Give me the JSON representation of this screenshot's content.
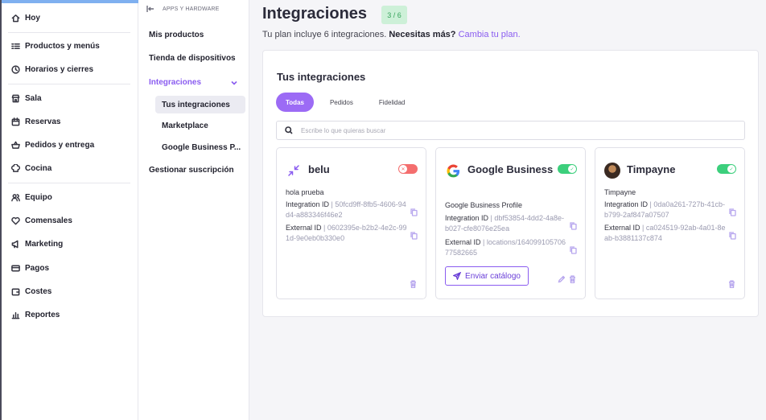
{
  "sidebar": {
    "items": [
      {
        "label": "Hoy",
        "icon": "home-icon"
      },
      {
        "label": "Productos y menús",
        "icon": "list-icon"
      },
      {
        "label": "Horarios y cierres",
        "icon": "clock-icon"
      },
      {
        "label": "Sala",
        "icon": "store-icon"
      },
      {
        "label": "Reservas",
        "icon": "calendar-icon"
      },
      {
        "label": "Pedidos y entrega",
        "icon": "basket-icon"
      },
      {
        "label": "Cocina",
        "icon": "chef-hat-icon"
      },
      {
        "label": "Equipo",
        "icon": "users-icon"
      },
      {
        "label": "Comensales",
        "icon": "heart-icon"
      },
      {
        "label": "Marketing",
        "icon": "megaphone-icon"
      },
      {
        "label": "Pagos",
        "icon": "credit-card-icon"
      },
      {
        "label": "Costes",
        "icon": "wallet-icon"
      },
      {
        "label": "Reportes",
        "icon": "bar-chart-icon"
      }
    ]
  },
  "subnav": {
    "header": "APPS Y HARDWARE",
    "items": [
      {
        "label": "Mis productos"
      },
      {
        "label": "Tienda de dispositivos"
      },
      {
        "label": "Integraciones"
      },
      {
        "label": "Gestionar suscripción"
      }
    ],
    "children": [
      {
        "label": "Tus integraciones"
      },
      {
        "label": "Marketplace"
      },
      {
        "label": "Google Business P..."
      }
    ]
  },
  "main": {
    "title": "Integraciones",
    "quota": "3 / 6",
    "plan_text": "Tu plan incluye 6 integraciones.",
    "plan_question": "Necesitas más?",
    "plan_link": "Cambia tu plan.",
    "panel_title": "Tus integraciones",
    "tabs": [
      {
        "label": "Todas"
      },
      {
        "label": "Pedidos"
      },
      {
        "label": "Fidelidad"
      }
    ],
    "search_placeholder": "Escribe lo que quieras buscar"
  },
  "cards": [
    {
      "name": "belu",
      "enabled": false,
      "description": "hola prueba",
      "integration_label": "Integration ID",
      "integration_id": "50fcd9ff-8fb5-4606-94d4-a883346f46e2",
      "external_label": "External ID",
      "external_id": "0602395e-b2b2-4e2c-991d-9e0eb0b330e0"
    },
    {
      "name": "Google Business",
      "enabled": true,
      "description": "Google Business Profile",
      "integration_label": "Integration ID",
      "integration_id": "dbf53854-4dd2-4a8e-b027-cfe8076e25ea",
      "external_label": "External ID",
      "external_id": "locations/16409910570677582665",
      "catalog_button": "Enviar catálogo"
    },
    {
      "name": "Timpayne",
      "enabled": true,
      "description": "Timpayne",
      "integration_label": "Integration ID",
      "integration_id": "0da0a261-727b-41cb-b799-2af847a07507",
      "external_label": "External ID",
      "external_id": "ca024519-92ab-4a01-8eab-b3881137c874"
    }
  ],
  "colors": {
    "accent": "#8a5cf0",
    "toggle_on": "#3ccf7c",
    "toggle_off": "#f46e6e",
    "quota_bg": "#cdf0d8"
  }
}
